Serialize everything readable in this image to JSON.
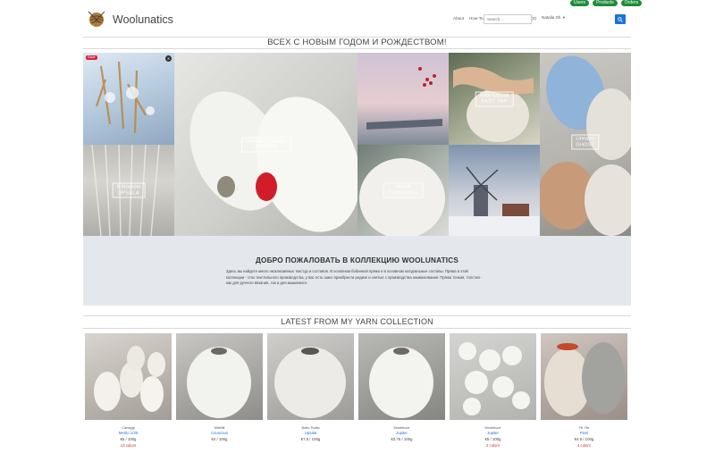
{
  "admin_pills": [
    "Users",
    "Products",
    "Orders"
  ],
  "header": {
    "brand": "Woolunatics",
    "nav": {
      "about": "About",
      "howto": "How-To Order",
      "collection": "Collection ▾",
      "cart": "(0)",
      "user": "Natalia Sh. ▾"
    },
    "search_placeholder": "Search..."
  },
  "banner": {
    "title": "ВСЕХ С НОВЫМ ГОДОМ И РОЖДЕСТВОМ!"
  },
  "mosaic": {
    "save_badge": "Save",
    "pin_icon": "pin-icon",
    "tiles": [
      {
        "line1": "Monteluce (Japan)",
        "line2": "JUPITER"
      },
      {
        "line1": "Filati Naturali",
        "line2": "BABY YAK"
      },
      {
        "line1": "Lineapiu",
        "line2": "GHOST"
      },
      {
        "line1": "B.Modesto",
        "line2": "UPSALA"
      },
      {
        "line1": "Millefili",
        "line2": "COUSCOUS"
      }
    ]
  },
  "welcome": {
    "title": "ДОБРО ПОЖАЛОВАТЬ В КОЛЛЕКЦИЮ WOOLUNATICS",
    "text": "Здесь вы найдете много эксклюзивных текстур и составов. В основном бобинная пряжа и в основном натуральные составы. Пряжа в этой коллекции - сток текстильного производства, у вас есть шанс приобрести редкие и снятые с производства наименования. Пряжа тонкая, толстая - как для ручного вязания, так и для машинного."
  },
  "latest": {
    "title": "LATEST FROM MY YARN COLLECTION",
    "products": [
      {
        "brand": "Cariaggi",
        "name": "Merilo 1/30",
        "price": "€5 / 100g",
        "colors": "13 colors"
      },
      {
        "brand": "Millefili",
        "name": "Couscous",
        "price": "€4 / 100g",
        "colors": ""
      },
      {
        "brand": "Botto Poala",
        "name": "Upsala",
        "price": "€7.5 / 100g",
        "colors": ""
      },
      {
        "brand": "Monteluce",
        "name": "Jupiter",
        "price": "€3.75 / 100g",
        "colors": ""
      },
      {
        "brand": "Monteluce",
        "name": "Jupiter",
        "price": "€5 / 100g",
        "colors": "2 colors"
      },
      {
        "brand": "Ftt. Re",
        "name": "Pixel",
        "price": "€4.5 / 100g",
        "colors": "4 colors"
      }
    ]
  },
  "colors": {
    "accent": "#1a73d9",
    "pill": "#1e8c3a",
    "sale": "#d12b2b",
    "welcome_bg": "#e4e7ec"
  }
}
